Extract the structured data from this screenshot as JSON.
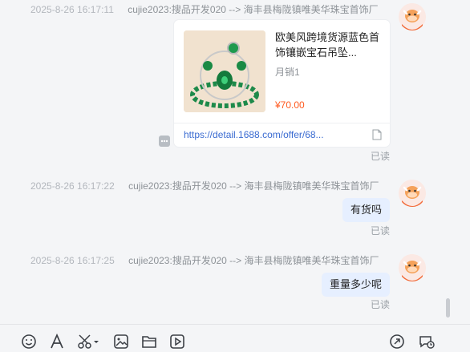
{
  "messages": [
    {
      "time": "2025-8-26 16:17:11",
      "route": "cujie2023:搜品开发020 --> 海丰县梅陇镇唯美华珠宝首饰厂",
      "type": "product",
      "product": {
        "title": "欧美风跨境货源蓝色首饰镶嵌宝石吊坠...",
        "sales": "月销1",
        "price": "¥70.00",
        "link": "https://detail.1688.com/offer/68..."
      },
      "status": "已读"
    },
    {
      "time": "2025-8-26 16:17:22",
      "route": "cujie2023:搜品开发020 --> 海丰县梅陇镇唯美华珠宝首饰厂",
      "type": "text",
      "text": "有货吗",
      "status": "已读"
    },
    {
      "time": "2025-8-26 16:17:25",
      "route": "cujie2023:搜品开发020 --> 海丰县梅陇镇唯美华珠宝首饰厂",
      "type": "text",
      "text": "重量多少呢",
      "status": "已读"
    }
  ],
  "toolbar": {
    "left": [
      "emoji-icon",
      "font-icon",
      "scissors-icon",
      "image-icon",
      "folder-icon",
      "video-icon"
    ],
    "right": [
      "share-icon",
      "chat-history-icon"
    ]
  },
  "colors": {
    "bubble": "#e6efff",
    "price": "#ff5a1f",
    "link": "#3a6bd1",
    "avatar": "#f26b3a"
  }
}
